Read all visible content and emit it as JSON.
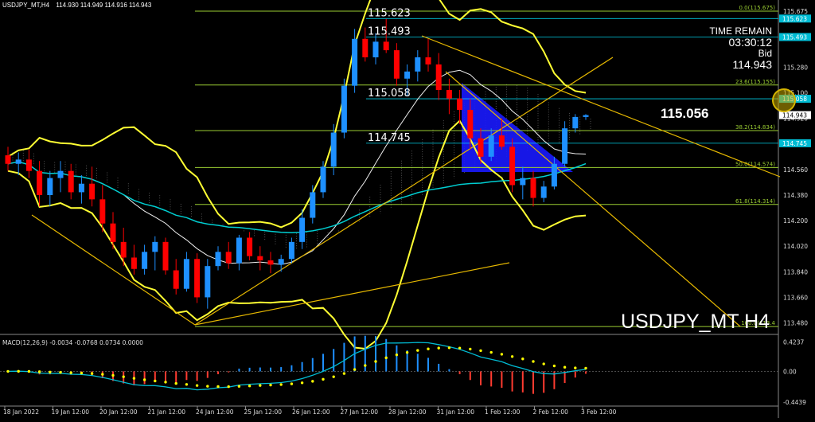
{
  "window": {
    "info_symbol": "USDJPY_MT,H4",
    "info_ohlc": "114.930 114.949 114.916 114.943",
    "watermark": "USDJPY_MT H4"
  },
  "panel_info": {
    "time_remain_label": "TIME REMAIN",
    "time_remain_value": "03:30:12",
    "bid_label": "Bid",
    "bid_value": "114.943",
    "big_price": "115.056"
  },
  "colors": {
    "background": "#000000",
    "bull": "#1e90ff",
    "bear": "#ff0000",
    "bands": "#ffff33",
    "ma": "#00ced1",
    "fib": "#9acd32",
    "triangle": "#1a1aff",
    "macd_line": "#00bcd4",
    "signal": "#ffff00",
    "hist_pos": "#1e90ff",
    "hist_neg": "#ff3b30"
  },
  "chart_data": {
    "type": "candlestick",
    "symbol": "USDJPY_MT",
    "timeframe": "H4",
    "ylim": [
      113.41,
      115.72
    ],
    "y_ticks": [
      "115.675",
      "115.490",
      "115.280",
      "115.100",
      "114.920",
      "114.740",
      "114.560",
      "114.380",
      "114.200",
      "114.020",
      "113.840",
      "113.660",
      "113.480"
    ],
    "x_labels": [
      "18 Jan 2022",
      "19 Jan 12:00",
      "20 Jan 12:00",
      "21 Jan 12:00",
      "24 Jan 12:00",
      "25 Jan 12:00",
      "26 Jan 12:00",
      "27 Jan 12:00",
      "28 Jan 12:00",
      "31 Jan 12:00",
      "1 Feb 12:00",
      "2 Feb 12:00",
      "3 Feb 12:00"
    ],
    "candles": [
      [
        114.66,
        114.72,
        114.55,
        114.6
      ],
      [
        114.6,
        114.68,
        114.52,
        114.63
      ],
      [
        114.63,
        114.7,
        114.5,
        114.55
      ],
      [
        114.55,
        114.62,
        114.3,
        114.38
      ],
      [
        114.38,
        114.55,
        114.3,
        114.5
      ],
      [
        114.5,
        114.62,
        114.4,
        114.55
      ],
      [
        114.55,
        114.6,
        114.35,
        114.4
      ],
      [
        114.4,
        114.52,
        114.32,
        114.46
      ],
      [
        114.46,
        114.58,
        114.3,
        114.35
      ],
      [
        114.35,
        114.45,
        114.12,
        114.18
      ],
      [
        114.18,
        114.26,
        114.0,
        114.05
      ],
      [
        114.05,
        114.15,
        113.88,
        113.94
      ],
      [
        113.94,
        114.03,
        113.82,
        113.86
      ],
      [
        113.86,
        114.03,
        113.82,
        113.98
      ],
      [
        113.98,
        114.09,
        113.85,
        114.05
      ],
      [
        114.05,
        114.08,
        113.82,
        113.85
      ],
      [
        113.85,
        113.93,
        113.68,
        113.72
      ],
      [
        113.72,
        113.98,
        113.7,
        113.93
      ],
      [
        113.93,
        113.97,
        113.62,
        113.66
      ],
      [
        113.66,
        113.93,
        113.58,
        113.88
      ],
      [
        113.88,
        114.02,
        113.85,
        113.98
      ],
      [
        113.98,
        114.05,
        113.86,
        113.9
      ],
      [
        113.9,
        114.1,
        113.85,
        114.08
      ],
      [
        114.08,
        114.12,
        113.92,
        113.95
      ],
      [
        113.95,
        114.02,
        113.85,
        113.92
      ],
      [
        113.92,
        113.98,
        113.83,
        113.89
      ],
      [
        113.89,
        113.96,
        113.84,
        113.93
      ],
      [
        113.93,
        114.08,
        113.9,
        114.05
      ],
      [
        114.05,
        114.28,
        114.0,
        114.22
      ],
      [
        114.22,
        114.45,
        114.18,
        114.4
      ],
      [
        114.4,
        114.62,
        114.36,
        114.58
      ],
      [
        114.58,
        114.88,
        114.52,
        114.82
      ],
      [
        114.82,
        115.2,
        114.78,
        115.15
      ],
      [
        115.15,
        115.55,
        115.1,
        115.48
      ],
      [
        115.48,
        115.56,
        115.32,
        115.35
      ],
      [
        115.35,
        115.52,
        115.3,
        115.46
      ],
      [
        115.46,
        115.62,
        115.38,
        115.4
      ],
      [
        115.4,
        115.45,
        115.15,
        115.2
      ],
      [
        115.2,
        115.3,
        115.08,
        115.25
      ],
      [
        115.25,
        115.4,
        115.18,
        115.35
      ],
      [
        115.35,
        115.48,
        115.25,
        115.3
      ],
      [
        115.3,
        115.38,
        115.05,
        115.12
      ],
      [
        115.12,
        115.2,
        114.95,
        115.06
      ],
      [
        115.06,
        115.12,
        114.88,
        114.98
      ],
      [
        114.98,
        115.06,
        114.7,
        114.78
      ],
      [
        114.78,
        114.85,
        114.6,
        114.65
      ],
      [
        114.65,
        114.85,
        114.62,
        114.8
      ],
      [
        114.8,
        114.92,
        114.7,
        114.72
      ],
      [
        114.72,
        114.78,
        114.4,
        114.45
      ],
      [
        114.45,
        114.58,
        114.35,
        114.5
      ],
      [
        114.5,
        114.55,
        114.3,
        114.36
      ],
      [
        114.36,
        114.48,
        114.33,
        114.44
      ],
      [
        114.44,
        114.65,
        114.42,
        114.6
      ],
      [
        114.6,
        114.9,
        114.58,
        114.85
      ],
      [
        114.85,
        114.95,
        114.82,
        114.93
      ],
      [
        114.93,
        114.95,
        114.91,
        114.943
      ]
    ],
    "fib_levels": [
      {
        "label": "0.0(115.675)",
        "value": 115.675
      },
      {
        "label": "23.6(115.155)",
        "value": 115.155
      },
      {
        "label": "38.2(114.834)",
        "value": 114.834
      },
      {
        "label": "50.0(114.574)",
        "value": 114.574
      },
      {
        "label": "61.8(114.314)",
        "value": 114.314
      },
      {
        "label": "100.0(113.4",
        "value": 113.454
      }
    ],
    "price_labels": [
      {
        "text": "115.623",
        "value": 115.623
      },
      {
        "text": "115.493",
        "value": 115.493
      },
      {
        "text": "115.058",
        "value": 115.058
      },
      {
        "text": "114.745",
        "value": 114.745
      }
    ],
    "axis_marks": [
      {
        "text": "115.623",
        "value": 115.623,
        "kind": "level"
      },
      {
        "text": "115.493",
        "value": 115.493,
        "kind": "level"
      },
      {
        "text": "115.058",
        "value": 115.058,
        "kind": "level"
      },
      {
        "text": "114.943",
        "value": 114.943,
        "kind": "bid"
      },
      {
        "text": "114.745",
        "value": 114.745,
        "kind": "level"
      }
    ],
    "macd": {
      "label": "MACD(12,26,9) -0.0034 -0.0768 0.0734 0.0000",
      "ylim": [
        -0.48,
        0.49
      ],
      "y_ticks": [
        "0.4237",
        "0.00",
        "-0.4439"
      ]
    }
  }
}
